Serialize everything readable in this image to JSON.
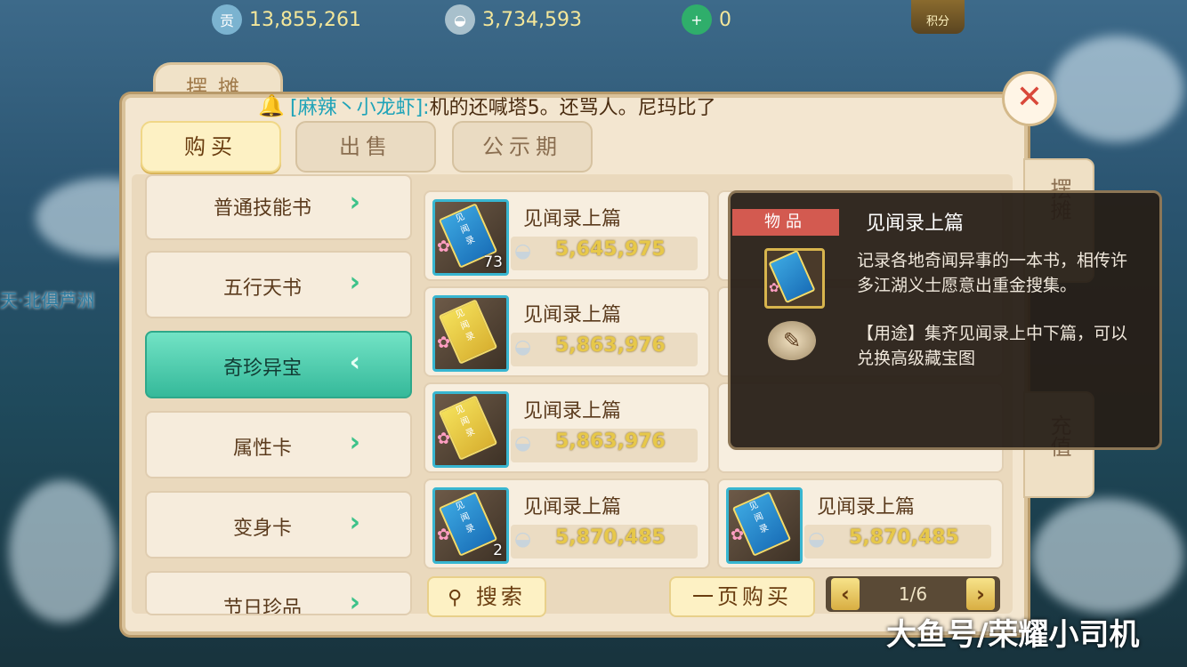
{
  "currencies": [
    {
      "icon": "contribution-coin-icon",
      "glyph": "贡",
      "value": "13,855,261",
      "color": "#7bb3d0"
    },
    {
      "icon": "silver-ingot-icon",
      "glyph": "",
      "value": "3,734,593",
      "color": "#a8c0cc"
    },
    {
      "icon": "jade-icon",
      "glyph": "+",
      "value": "0",
      "color": "#2fae6b"
    }
  ],
  "score_button": "积分",
  "panel_title": "摆摊",
  "broadcast": {
    "user": "[麻辣丶小龙虾]:",
    "message": "机的还喊塔5。还骂人。尼玛比了"
  },
  "tabs": [
    "购买",
    "出售",
    "公示期"
  ],
  "categories": [
    "普通技能书",
    "五行天书",
    "奇珍异宝",
    "属性卡",
    "变身卡",
    "节日珍品"
  ],
  "active_category": "奇珍异宝",
  "items": [
    {
      "name": "见闻录上篇",
      "price": "5,645,975",
      "count": "73"
    },
    {
      "name": "见闻录上篇",
      "price": "5,863,976",
      "count": ""
    },
    {
      "name": "见闻录上篇",
      "price": "5,863,976",
      "count": ""
    },
    {
      "name": "见闻录上篇",
      "price": "5,870,485",
      "count": "2"
    },
    {
      "name": "见闻录上篇",
      "price": "5,870,485",
      "count": ""
    }
  ],
  "search_button": "搜索",
  "buy_page_button": "一页购买",
  "pager": {
    "label": "1/6",
    "prev": "‹",
    "next": "›"
  },
  "side_tabs": [
    "摆摊",
    "充值"
  ],
  "tooltip": {
    "badge": "物品",
    "title": "见闻录上篇",
    "description": "记录各地奇闻异事的一本书，相传许多江湖义士愿意出重金搜集。",
    "usage": "【用途】集齐见闻录上中下篇，可以兑换高级藏宝图"
  },
  "map_label": "天·北俱芦洲",
  "watermark": "大鱼号/荣耀小司机"
}
